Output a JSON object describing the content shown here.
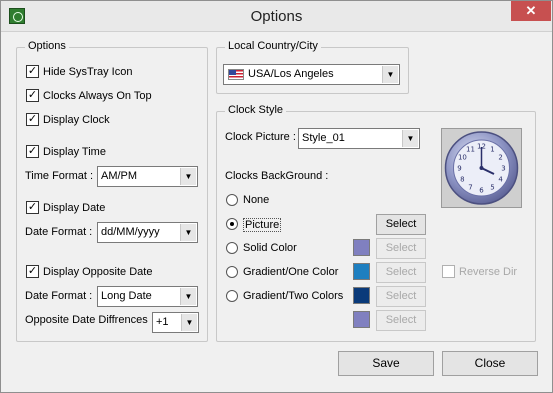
{
  "window": {
    "title": "Options",
    "close_label": "✕"
  },
  "options": {
    "group_title": "Options",
    "hide_systray": {
      "label": "Hide SysTray Icon",
      "checked": true
    },
    "always_on_top": {
      "label": "Clocks Always On Top",
      "checked": true
    },
    "display_clock": {
      "label": "Display Clock",
      "checked": true
    },
    "display_time": {
      "label": "Display Time",
      "checked": true
    },
    "time_format": {
      "label": "Time Format :",
      "value": "AM/PM"
    },
    "display_date": {
      "label": "Display Date",
      "checked": true
    },
    "date_format": {
      "label": "Date Format :",
      "value": "dd/MM/yyyy"
    },
    "display_opposite_date": {
      "label": "Display Opposite Date",
      "checked": true
    },
    "opposite_date_format": {
      "label": "Date Format :",
      "value": "Long Date"
    },
    "opposite_date_diff": {
      "label": "Opposite Date Diffrences",
      "value": "+1"
    }
  },
  "country": {
    "group_title": "Local Country/City",
    "value": "USA/Los Angeles",
    "flag_icon": "us-flag-icon"
  },
  "clock_style": {
    "group_title": "Clock Style",
    "picture_label": "Clock Picture :",
    "picture_value": "Style_01",
    "background_label": "Clocks BackGround :",
    "none_label": "None",
    "picture_option_label": "Picture",
    "solid_label": "Solid Color",
    "gradient_one_label": "Gradient/One Color",
    "gradient_two_label": "Gradient/Two Colors",
    "select_label": "Select",
    "reverse_dir_label": "Reverse Dir",
    "selected_background": "Picture",
    "colors": {
      "solid": "#8080c0",
      "gradient_one": "#1e7fc0",
      "gradient_two_a": "#0a3a7a",
      "gradient_two_b": "#8080c0"
    },
    "clock_numbers": [
      "12",
      "1",
      "2",
      "3",
      "4",
      "5",
      "6",
      "7",
      "8",
      "9",
      "10",
      "11"
    ]
  },
  "footer": {
    "save_label": "Save",
    "close_label": "Close"
  }
}
